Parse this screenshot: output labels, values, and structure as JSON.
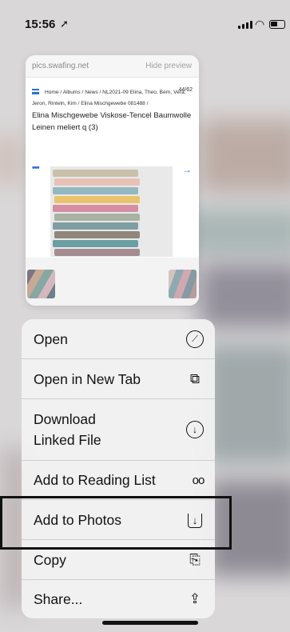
{
  "status": {
    "time": "15:56",
    "location_symbol": "➚"
  },
  "preview": {
    "domain": "pics.swafing.net",
    "hide_label": "Hide preview",
    "breadcrumb": "Home / Albums / News / NL2021-09 Elina, Theo, Bern, Vera, Jeron, Rinteln, Kim / Elina Mischgewebe 081488 /",
    "count": "44/62",
    "title": "Elina Mischgewebe Viskose-Tencel Baumwolle Leinen meliert q (3)",
    "dots": "•••",
    "fabric_colors": [
      "#c8c0a9",
      "#e7c2b6",
      "#93b8bd",
      "#e8c26c",
      "#d48fa3",
      "#a8b3a2",
      "#7f9ea3",
      "#8f8779",
      "#6aa0a4",
      "#a58c93",
      "#5f7f86",
      "#7e7684",
      "#4f5f6b"
    ]
  },
  "menu": {
    "items": [
      {
        "label": "Open",
        "icon": "compass-icon",
        "glyph": "⊘"
      },
      {
        "label": "Open in New Tab",
        "icon": "plus-square-icon",
        "glyph": "⧉"
      },
      {
        "label_line1": "Download",
        "label_line2": "Linked File",
        "icon": "download-circle-icon",
        "glyph": "⊕"
      },
      {
        "label": "Add to Reading List",
        "icon": "glasses-icon",
        "glyph": "oo"
      },
      {
        "label": "Add to Photos",
        "icon": "save-tray-icon",
        "glyph": "⤓"
      },
      {
        "label": "Copy",
        "icon": "copy-icon",
        "glyph": "⎘"
      },
      {
        "label": "Share...",
        "icon": "share-icon",
        "glyph": "⇧"
      }
    ]
  }
}
